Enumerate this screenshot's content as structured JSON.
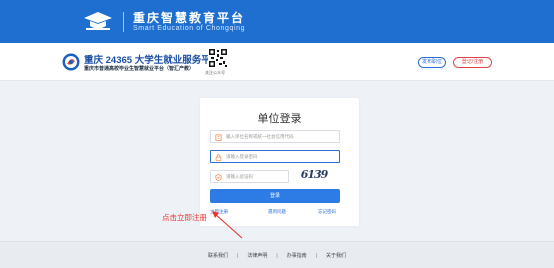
{
  "banner": {
    "title": "重庆智慧教育平台",
    "subtitle": "Smart Education of Chongqing"
  },
  "subheader": {
    "title": "重庆 24365 大学生就业服务平台",
    "desc": "重庆市普通高校毕业生智慧就业平台（智汇产教）",
    "qr_label": "关注公众号",
    "publish_button": "发布职位",
    "login_register_button": "登记/注册"
  },
  "login": {
    "title": "单位登录",
    "org_placeholder": "输入单位名称或统一社会信用代码",
    "password_placeholder": "请输入登录密码",
    "captcha_placeholder": "请输入验证码",
    "captcha_text": "6139",
    "submit_label": "登录",
    "register_link": "立即注册",
    "help_link": "遇到问题",
    "forgot_link": "忘记密码"
  },
  "annotation": {
    "text": "点击立即注册"
  },
  "footer": {
    "links": [
      "联系我们",
      "法律声明",
      "办事指南",
      "关于我们"
    ]
  },
  "colors": {
    "banner_bg": "#1f6fd0",
    "primary": "#2d7be5",
    "annotation_red": "#e8332f",
    "page_bg": "#eef2f7"
  }
}
